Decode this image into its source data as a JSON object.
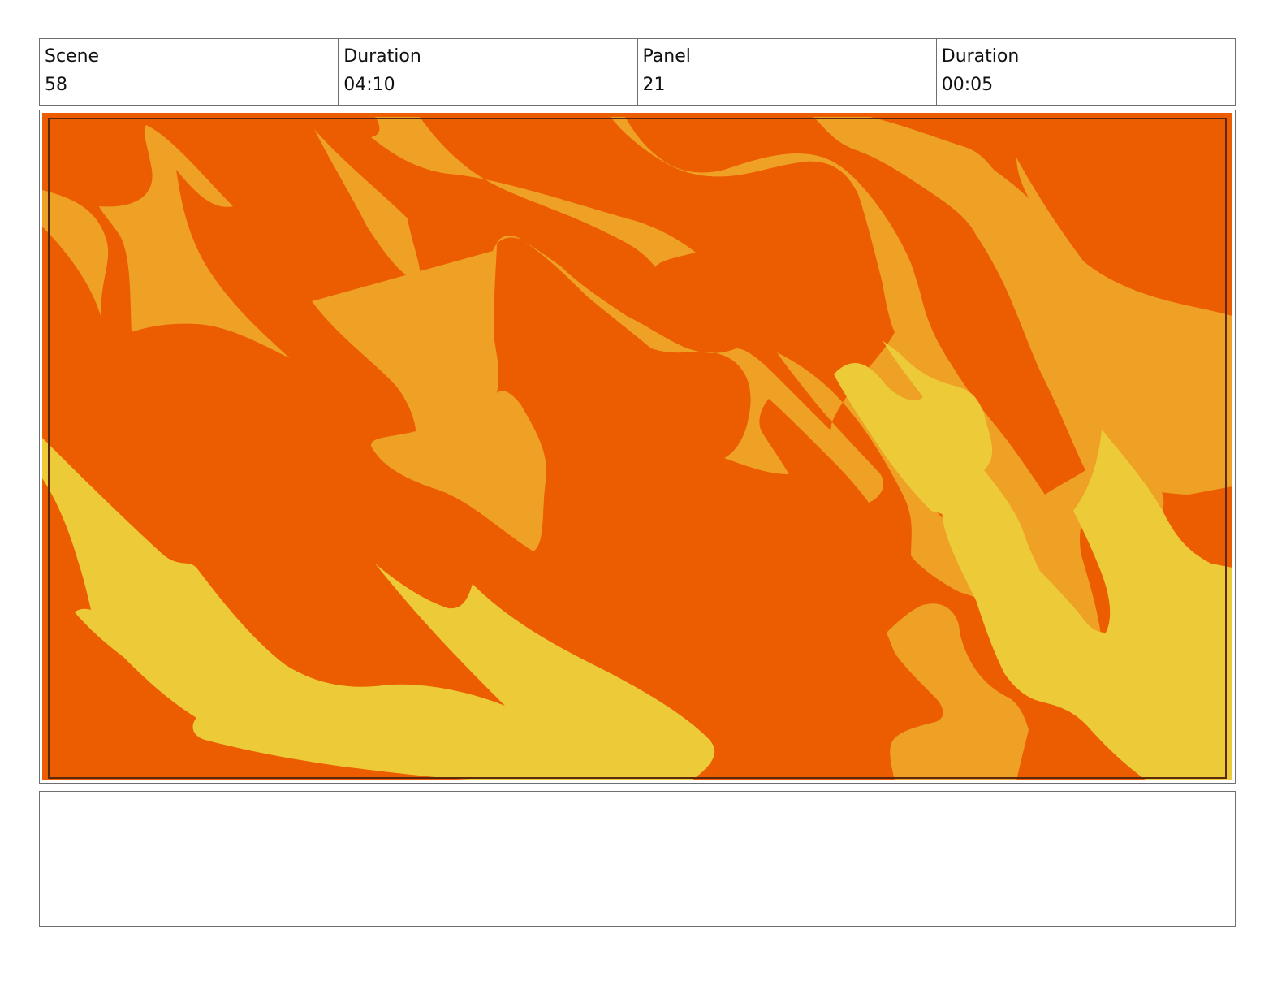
{
  "header": {
    "cells": [
      {
        "label": "Scene",
        "value": "58"
      },
      {
        "label": "Duration",
        "value": "04:10"
      },
      {
        "label": "Panel",
        "value": "21"
      },
      {
        "label": "Duration",
        "value": "00:05"
      }
    ]
  },
  "panel": {
    "artwork": "flames-illustration",
    "colors": {
      "base": "#ec5c00",
      "mid": "#eea125",
      "light": "#edca38",
      "safe_frame": "#5a2a10"
    }
  },
  "notes": {
    "text": ""
  }
}
